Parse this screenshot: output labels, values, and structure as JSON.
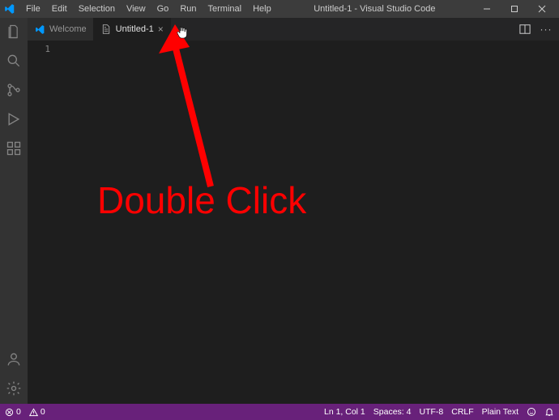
{
  "titlebar": {
    "menus": [
      "File",
      "Edit",
      "Selection",
      "View",
      "Go",
      "Run",
      "Terminal",
      "Help"
    ],
    "title": "Untitled-1 - Visual Studio Code"
  },
  "tabs": {
    "welcome": "Welcome",
    "untitled": "Untitled-1"
  },
  "gutter": {
    "line1": "1"
  },
  "status": {
    "errors": "0",
    "warnings": "0",
    "lncol": "Ln 1, Col 1",
    "spaces": "Spaces: 4",
    "encoding": "UTF-8",
    "eol": "CRLF",
    "lang": "Plain Text"
  },
  "annotation": {
    "text": "Double Click"
  }
}
